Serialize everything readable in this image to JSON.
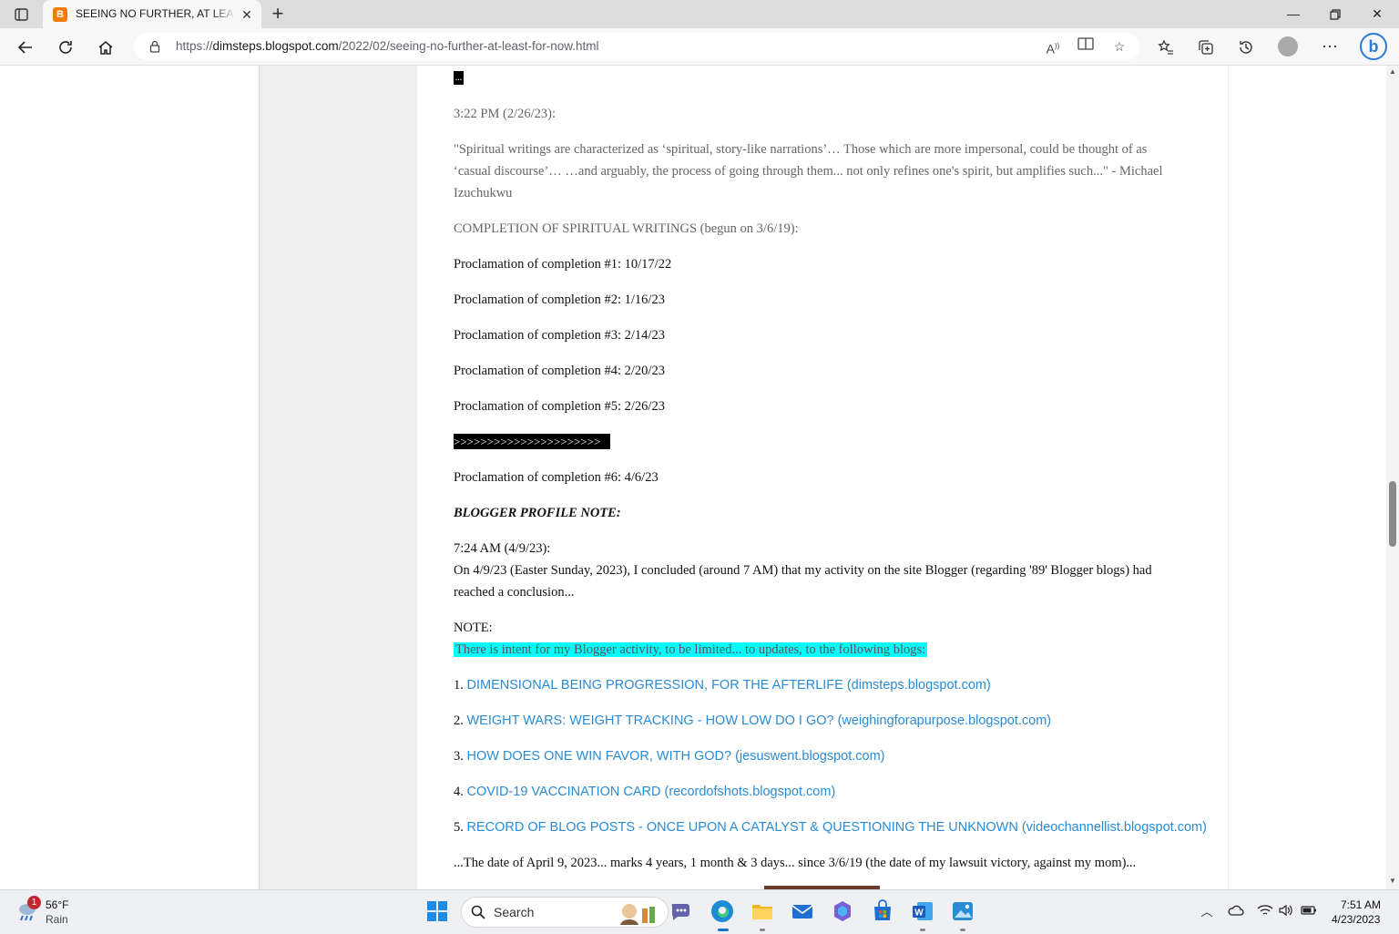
{
  "browser": {
    "tab_title": "SEEING NO FURTHER, AT LEAST FOR NOW",
    "favicon_letter": "B",
    "url_scheme": "https://",
    "url_host": "dimsteps.blogspot.com",
    "url_path": "/2022/02/seeing-no-further-at-least-for-now.html",
    "accent_color": "#2c79d6"
  },
  "post": {
    "ellipsis": "...",
    "time_stamp": "3:22 PM (2/26/23):",
    "quote_line1": "\"Spiritual writings are characterized as ‘spiritual, story-like narrations’… Those which are more impersonal, could be thought of as",
    "quote_line2": "‘casual discourse’… …and arguably, the process of going through them... not only refines one's spirit, but amplifies such...\" - Michael",
    "quote_line3": "Izuchukwu",
    "completion_heading": "COMPLETION OF SPIRITUAL WRITINGS (begun on 3/6/19):",
    "proclamations": [
      "Proclamation of completion #1: 10/17/22",
      "Proclamation of completion #2: 1/16/23",
      "Proclamation of completion #3: 2/14/23",
      "Proclamation of completion #4: 2/20/23",
      "Proclamation of completion #5: 2/26/23"
    ],
    "arrows": ">>>>>>>>>>>>>>>>>>>>>>",
    "proclamation6": "Proclamation of completion #6: 4/6/23",
    "profile_note": "BLOGGER PROFILE NOTE:",
    "note_time": "7:24 AM (4/9/23):",
    "note_line1": "On 4/9/23 (Easter Sunday, 2023), I concluded (around 7 AM) that my activity on the site Blogger (regarding '89' Blogger blogs) had",
    "note_line2": "reached a conclusion...",
    "note_label": "NOTE:",
    "highlight_text": "There is intent for my Blogger activity, to be limited... to updates, to the following blogs:",
    "highlight_color": "#00ffff",
    "blog_links": [
      {
        "num": "1.",
        "text": "DIMENSIONAL BEING PROGRESSION, FOR THE AFTERLIFE (dimsteps.blogspot.com)"
      },
      {
        "num": "2.",
        "text": "WEIGHT WARS: WEIGHT TRACKING - HOW LOW DO I GO? (weighingforapurpose.blogspot.com)"
      },
      {
        "num": "3.",
        "text": "HOW DOES ONE WIN FAVOR, WITH GOD? (jesuswent.blogspot.com)"
      },
      {
        "num": "4.",
        "text": "COVID-19 VACCINATION CARD (recordofshots.blogspot.com)"
      },
      {
        "num": "5.",
        "text": "RECORD OF BLOG POSTS - ONCE UPON A CATALYST & QUESTIONING THE UNKNOWN (videochannellist.blogspot.com)"
      }
    ],
    "link_color": "#2a8bd5",
    "closing_line": "...The date of April 9, 2023... marks 4 years, 1 month & 3 days... since 3/6/19 (the date of my lawsuit victory, against my mom)..."
  },
  "taskbar": {
    "weather_temp": "56°F",
    "weather_condition": "Rain",
    "weather_badge": "1",
    "search_label": "Search",
    "clock_time": "7:51 AM",
    "clock_date": "4/23/2023"
  }
}
